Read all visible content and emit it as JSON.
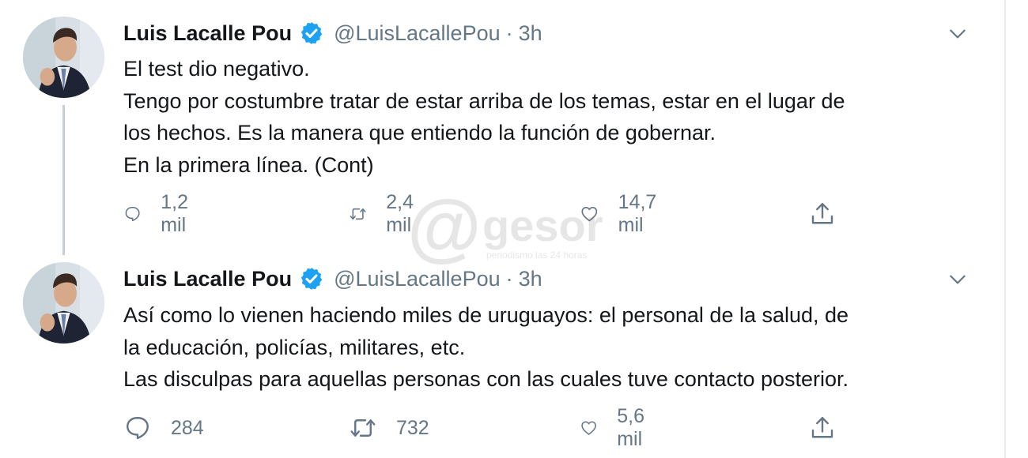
{
  "tweets": [
    {
      "author_name": "Luis Lacalle Pou",
      "handle": "@LuisLacallePou",
      "separator": "·",
      "time": "3h",
      "lines": [
        "El test dio negativo.",
        "Tengo por costumbre tratar de estar arriba de los temas, estar en el lugar de",
        "los hechos. Es la manera que entiendo la función de gobernar.",
        "En la primera línea. (Cont)"
      ],
      "replies": "1,2 mil",
      "retweets": "2,4 mil",
      "likes": "14,7 mil"
    },
    {
      "author_name": "Luis Lacalle Pou",
      "handle": "@LuisLacallePou",
      "separator": "·",
      "time": "3h",
      "lines": [
        "Así como lo vienen haciendo miles de uruguayos: el personal de la salud, de",
        "la educación, policías, militares, etc.",
        "Las disculpas para aquellas personas con las cuales tuve contacto posterior."
      ],
      "replies": "284",
      "retweets": "732",
      "likes": "5,6 mil"
    }
  ],
  "watermark": {
    "at": "@",
    "word": "gesor",
    "tagline": "periodismo las 24 horas"
  },
  "colors": {
    "text": "#14171a",
    "secondary": "#657786",
    "verified": "#1da1f2",
    "thread_line": "#c4cfd6"
  },
  "icons": {
    "verified": "verified-badge-icon",
    "caret": "chevron-down-icon",
    "reply": "reply-bubble-icon",
    "retweet": "retweet-icon",
    "like": "heart-icon",
    "share": "share-upload-icon"
  }
}
